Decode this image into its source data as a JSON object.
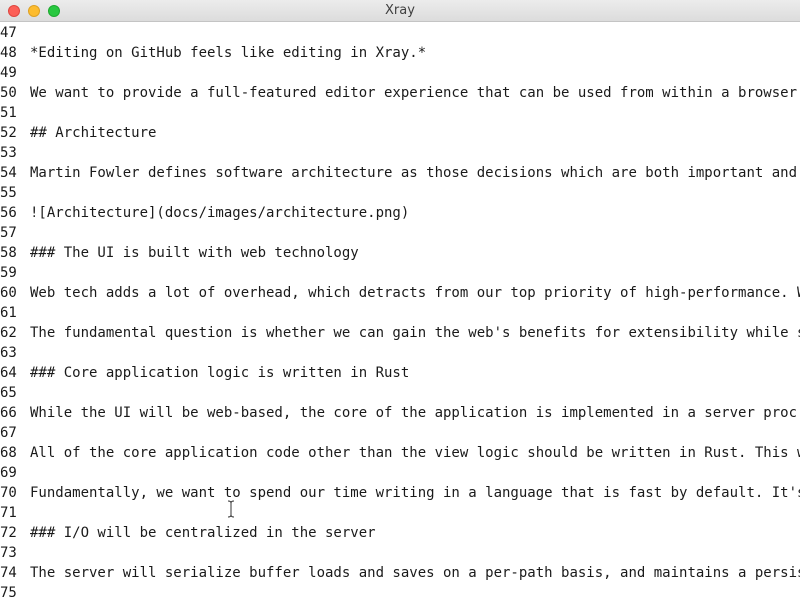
{
  "window": {
    "title": "Xray"
  },
  "editor": {
    "lines": [
      {
        "number": "",
        "text": ""
      },
      {
        "number": "47",
        "text": ""
      },
      {
        "number": "48",
        "text": "*Editing on GitHub feels like editing in Xray.*"
      },
      {
        "number": "49",
        "text": ""
      },
      {
        "number": "50",
        "text": "We want to provide a full-featured editor experience that can be used from within a browser"
      },
      {
        "number": "51",
        "text": ""
      },
      {
        "number": "52",
        "text": "## Architecture"
      },
      {
        "number": "53",
        "text": ""
      },
      {
        "number": "54",
        "text": "Martin Fowler defines software architecture as those decisions which are both important and"
      },
      {
        "number": "55",
        "text": ""
      },
      {
        "number": "56",
        "text": "![Architecture](docs/images/architecture.png)"
      },
      {
        "number": "57",
        "text": ""
      },
      {
        "number": "58",
        "text": "### The UI is built with web technology"
      },
      {
        "number": "59",
        "text": ""
      },
      {
        "number": "60",
        "text": "Web tech adds a lot of overhead, which detracts from our top priority of high-performance. W"
      },
      {
        "number": "61",
        "text": ""
      },
      {
        "number": "62",
        "text": "The fundamental question is whether we can gain the web's benefits for extensibility while s"
      },
      {
        "number": "63",
        "text": ""
      },
      {
        "number": "64",
        "text": "### Core application logic is written in Rust"
      },
      {
        "number": "65",
        "text": ""
      },
      {
        "number": "66",
        "text": "While the UI will be web-based, the core of the application is implemented in a server proc"
      },
      {
        "number": "67",
        "text": ""
      },
      {
        "number": "68",
        "text": "All of the core application code other than the view logic should be written in Rust. This w"
      },
      {
        "number": "69",
        "text": ""
      },
      {
        "number": "70",
        "text": "Fundamentally, we want to spend our time writing in a language that is fast by default. It's"
      },
      {
        "number": "71",
        "text": ""
      },
      {
        "number": "72",
        "text": "### I/O will be centralized in the server"
      },
      {
        "number": "73",
        "text": ""
      },
      {
        "number": "74",
        "text": "The server will serialize buffer loads and saves on a per-path basis, and maintains a persis"
      },
      {
        "number": "75",
        "text": ""
      }
    ]
  },
  "icons": {
    "close": "close-button",
    "minimize": "minimize-button",
    "zoom": "zoom-button",
    "cursor": "ibeam-cursor-icon"
  },
  "colors": {
    "close": "#fc5f57",
    "minimize": "#fdbc2e",
    "zoom": "#28c840",
    "text": "#1a1a1a",
    "background": "#ffffff"
  }
}
